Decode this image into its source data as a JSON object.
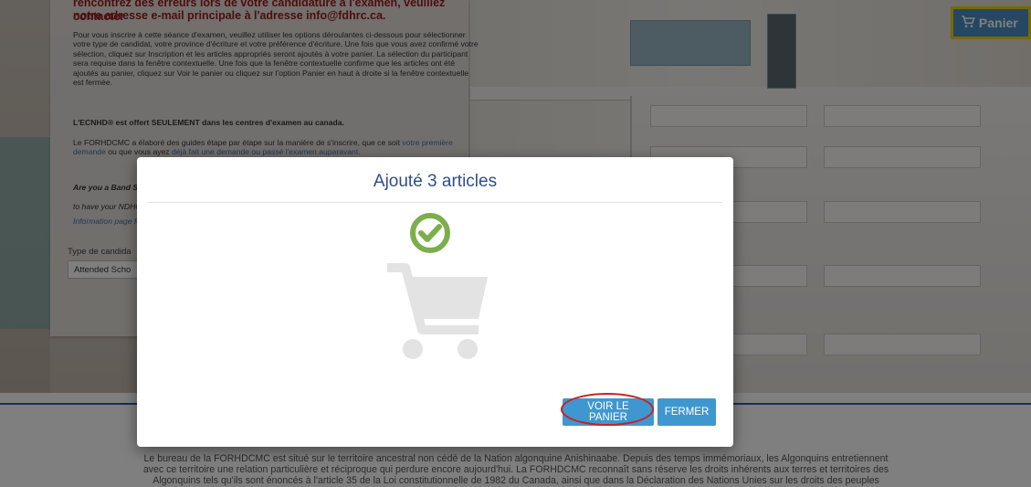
{
  "header": {
    "cart_button_label": "Panier",
    "cart_icon": "shopping-cart-icon",
    "cart_highlight_color": "#f0d000"
  },
  "info_panel": {
    "warning_line1": "rencontrez des erreurs lors de votre candidature à l'examen, veuillez contacter",
    "warning_line2": "notre adresse e-mail principale à l'adresse info@fdhrc.ca.",
    "instructions": "Pour vous inscrire à cette séance d'examen, veuillez utiliser les options déroulantes ci-dessous pour sélectionner votre type de candidat, votre province d'écriture et votre préférence d'écriture. Une fois que vous avez confirmé votre sélection, cliquez sur Inscription et les articles appropriés seront ajoutés à votre panier. La sélection du participant sera requise dans la fenêtre contextuelle. Une fois que la fenêtre contextuelle confirme que les articles ont été ajoutés au panier, cliquez sur Voir le panier ou cliquez sur l'option Panier en haut à droite si la fenêtre contextuelle est fermée.",
    "ecnhd_notice": "L'ECNHD® est offert SEULEMENT dans les centres d'examen au canada.",
    "guides_prefix": "Le FORHDCMC a élaboré des guides étape par étape sur la manière de s'inscrire, que ce soit",
    "guides_link1": "votre première demande",
    "guides_mid": "ou que vous ayez",
    "guides_link2": "déjà fait une demande ou passé l'examen auparavant.",
    "band_question": "Are you a Band S",
    "ndhc_line": "to have your NDHC",
    "info_link": "Information page fo",
    "candidate_type_label": "Type de candida",
    "candidate_type_value": "Attended Scho"
  },
  "modal": {
    "title": "Ajouté 3 articles",
    "success_icon": "check-circle-icon",
    "success_color": "#7cae4c",
    "cart_icon": "shopping-cart-icon",
    "view_cart_label": "VOIR LE PANIER",
    "close_label": "FERMER",
    "button_color": "#3f97cf",
    "annotation_color": "#d01d1d"
  },
  "footer": {
    "line1": "Le bureau de la FORHDCMC est situé sur le territoire ancestral non cédé de la Nation algonquine Anishinaabe. Depuis des temps immémoriaux, les Algonquins entretiennent",
    "line2": "avec ce territoire une relation particulière et réciproque qui perdure encore aujourd'hui. La FORHDCMC reconnaît sans réserve les droits inhérents aux terres et territoires des",
    "line3": "Algonquins tels qu'ils sont énoncés à l'article 35 de la Loi constitutionnelle de 1982 du Canada, ainsi que dans la Déclaration des Nations Unies sur les droits des peuples"
  }
}
